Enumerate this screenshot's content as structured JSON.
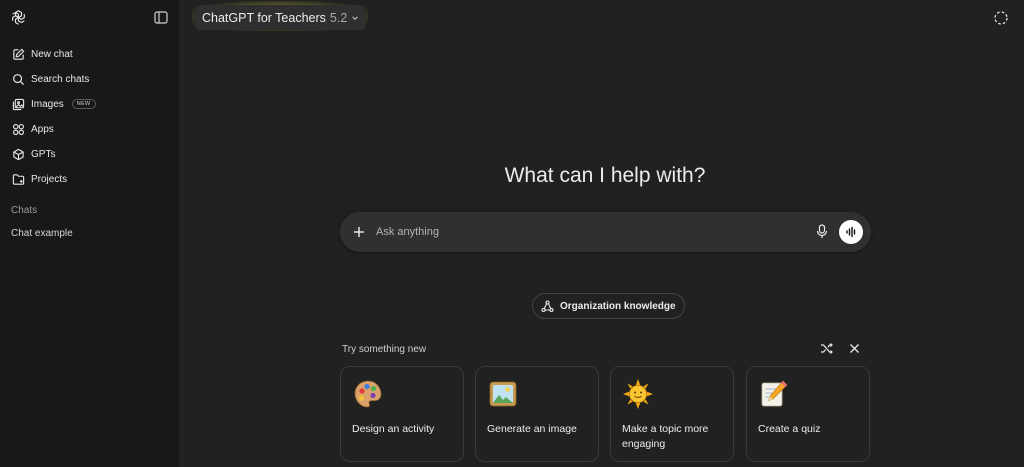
{
  "sidebar": {
    "items": [
      {
        "label": "New chat",
        "icon": "new-chat-icon"
      },
      {
        "label": "Search chats",
        "icon": "search-icon"
      },
      {
        "label": "Images",
        "icon": "images-icon",
        "badge": "NEW"
      },
      {
        "label": "Apps",
        "icon": "apps-icon"
      },
      {
        "label": "GPTs",
        "icon": "gpts-icon"
      },
      {
        "label": "Projects",
        "icon": "projects-icon"
      }
    ],
    "section_title": "Chats",
    "chats": [
      "Chat example"
    ]
  },
  "header": {
    "model_name": "ChatGPT for Teachers",
    "model_version": "5.2"
  },
  "main": {
    "heading": "What can I help with?",
    "composer": {
      "placeholder": "Ask anything"
    },
    "org_button": "Organization knowledge",
    "try_title": "Try something new",
    "cards": [
      {
        "label": "Design an activity",
        "icon": "palette-icon"
      },
      {
        "label": "Generate an image",
        "icon": "framed-picture-icon"
      },
      {
        "label": "Make a topic more engaging",
        "icon": "sun-icon"
      },
      {
        "label": "Create a quiz",
        "icon": "memo-pencil-icon"
      }
    ]
  },
  "colors": {
    "sidebar_bg": "#181818",
    "main_bg": "#212121",
    "composer_bg": "#303030",
    "highlight": "#eeee3c"
  }
}
